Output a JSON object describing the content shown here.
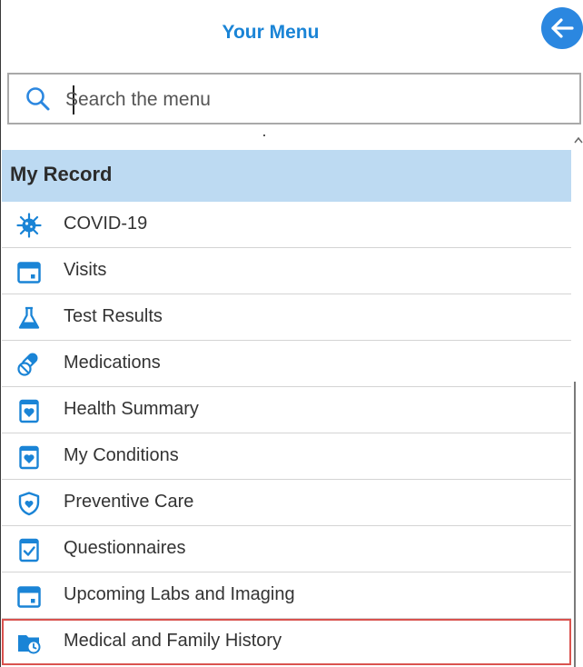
{
  "header": {
    "title": "Your Menu",
    "back_icon": "arrow-left-icon",
    "accent_color": "#2b87e0"
  },
  "search": {
    "placeholder": "Search the menu",
    "value": ""
  },
  "section": {
    "title": "My Record",
    "background": "#bddaf2"
  },
  "menu": {
    "items": [
      {
        "label": "COVID-19",
        "icon": "virus-icon"
      },
      {
        "label": "Visits",
        "icon": "calendar-icon"
      },
      {
        "label": "Test Results",
        "icon": "flask-icon"
      },
      {
        "label": "Medications",
        "icon": "pills-icon"
      },
      {
        "label": "Health Summary",
        "icon": "heart-clipboard-icon"
      },
      {
        "label": "My Conditions",
        "icon": "heart-clipboard-icon"
      },
      {
        "label": "Preventive Care",
        "icon": "shield-heart-icon"
      },
      {
        "label": "Questionnaires",
        "icon": "checklist-icon"
      },
      {
        "label": "Upcoming Labs and Imaging",
        "icon": "calendar-icon"
      },
      {
        "label": "Medical and Family History",
        "icon": "folder-clock-icon",
        "highlighted": true
      }
    ]
  }
}
